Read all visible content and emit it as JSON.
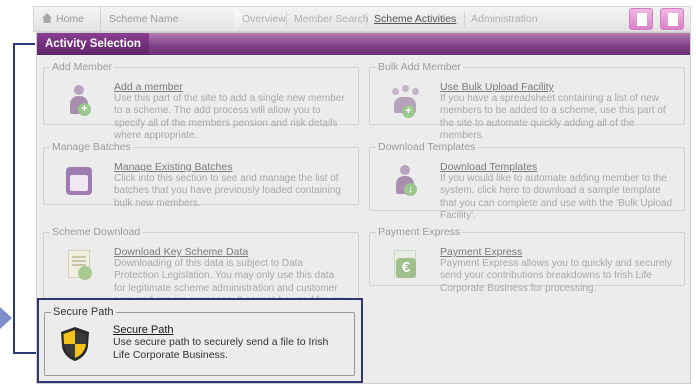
{
  "nav": {
    "home": "Home",
    "scheme": "Scheme Name",
    "links": [
      {
        "label": "Overview",
        "active": false
      },
      {
        "label": "Member Search",
        "active": false
      },
      {
        "label": "Scheme Activities",
        "active": true
      },
      {
        "label": "Administration",
        "active": false
      }
    ],
    "icons": [
      "document-icon",
      "documents-icon"
    ]
  },
  "panel": {
    "title": "Activity Selection"
  },
  "sections": [
    {
      "legend": "Add Member",
      "title": "Add a member",
      "desc": "Use this part of the site to add a single new member to a scheme. The add process will allow you to specify all of the members pension and risk details where appropriate.",
      "icon": "add-person-icon"
    },
    {
      "legend": "Bulk Add Member",
      "title": "Use Bulk Upload Facility",
      "desc": "If you have a spreadsheet containing a list of new members to be added to a scheme, use this part of the site to automate quickly adding all of the members.",
      "icon": "add-group-icon"
    },
    {
      "legend": "Manage Batches",
      "title": "Manage Existing Batches",
      "desc": "Click into this section to see and manage the list of batches that you have previously loaded containing bulk new members.",
      "icon": "batch-icon"
    },
    {
      "legend": "Download Templates",
      "title": "Download Templates",
      "desc": "If you would like to automate adding member to the system, click here to download a sample template that you can complete and use with the 'Bulk Upload Facility'.",
      "icon": "download-person-icon"
    },
    {
      "legend": "Scheme Download",
      "title": "Download Key Scheme Data",
      "desc": "Downloading of this data is subject to Data Protection Legislation. You may only use this data for legitimate scheme administration and customer care and service purposes. It cannot be used for any other purpose.",
      "icon": "download-document-icon"
    },
    {
      "legend": "Payment Express",
      "title": "Payment Express",
      "desc": "Payment Express allows you to quickly and securely send your contributions breakdowns to Irish Life Corporate Business for processing.",
      "icon": "euro-document-icon"
    }
  ],
  "secure": {
    "legend": "Secure Path",
    "title": "Secure Path",
    "desc": "Use secure path to securely send a file to Irish Life Corporate Business.",
    "icon": "shield-icon"
  },
  "colors": {
    "accent": "#7d3f86",
    "highlight": "#2c3670",
    "pointer": "#7b8fcc"
  }
}
